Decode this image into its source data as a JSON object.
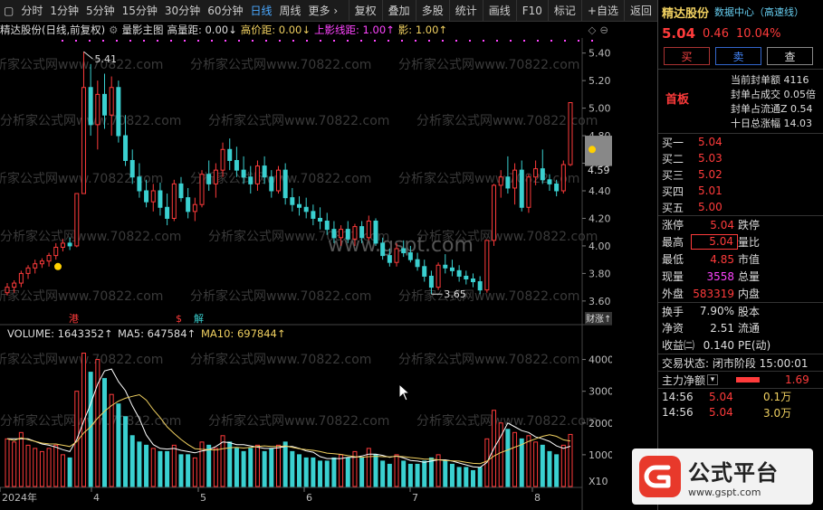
{
  "toolbar": {
    "items": [
      "分时",
      "1分钟",
      "5分钟",
      "15分钟",
      "30分钟",
      "60分钟",
      "日线",
      "周线",
      "更多 ›"
    ],
    "active_item": "日线",
    "tools": [
      "复权",
      "叠加",
      "多股",
      "统计",
      "画线",
      "F10",
      "标记",
      "+自选",
      "返回"
    ]
  },
  "infobar": {
    "stock_period": "精达股份(日线,前复权)",
    "mode": "量影主图",
    "high_vol_dist": "高量距: 0.00↓",
    "high_price_dist": "高价距: 0.00↓",
    "upper_shadow_dist": "上影线距: 1.00↑",
    "shadow": "影: 1.00↑"
  },
  "main_chart": {
    "y_ticks": [
      "5.40",
      "5.20",
      "5.00",
      "4.80",
      "4.60",
      "4.40",
      "4.20",
      "4.00",
      "3.80",
      "3.60"
    ],
    "y_min": 3.54,
    "y_max": 5.47,
    "high_label": "5.41",
    "low_label": "3.65",
    "current_price_label": "4.59",
    "markers": [
      "港",
      "$",
      "解"
    ],
    "right_badge": "财涨↑",
    "watermark_text": "分析家公式网www.70822.com",
    "site_text": "www.gspt.com"
  },
  "volume_chart": {
    "legend_volume": "VOLUME: 1643352↑",
    "legend_ma5": "MA5: 647584↑",
    "legend_ma10": "MA10: 697844↑",
    "y_ticks": [
      "40000",
      "30000",
      "20000",
      "10000"
    ],
    "y_unit": "X10",
    "x_labels": [
      "2024年",
      "4",
      "5",
      "6",
      "7",
      "8"
    ],
    "right_edge_label": "日"
  },
  "right_panel": {
    "name": "精达股份",
    "center": "数据中心（高速线）",
    "price": "5.04",
    "change": "0.46",
    "change_pct": "10.04%",
    "buy_label": "买",
    "sell_label": "卖",
    "query_label": "查",
    "board_label": "首板",
    "board_lines": [
      "当前封单额 4116",
      "封单占成交 0.05倍",
      "封单占流通Z 0.54",
      "十日总涨幅 14.03"
    ],
    "order_book": [
      {
        "label": "买一",
        "price": "5.04"
      },
      {
        "label": "买二",
        "price": "5.03"
      },
      {
        "label": "买三",
        "price": "5.02"
      },
      {
        "label": "买四",
        "price": "5.01"
      },
      {
        "label": "买五",
        "price": "5.00"
      }
    ],
    "stats": [
      {
        "l1": "涨停",
        "v1": "5.04",
        "l2": "跌停"
      },
      {
        "l1": "最高",
        "v1": "5.04",
        "l2": "量比"
      },
      {
        "l1": "最低",
        "v1": "4.85",
        "l2": "市值"
      },
      {
        "l1": "现量",
        "v1": "3558",
        "l2": "总量"
      },
      {
        "l1": "外盘",
        "v1": "583319",
        "l2": "内盘"
      },
      {
        "l1": "换手",
        "v1": "7.90%",
        "l2": "股本"
      },
      {
        "l1": "净资",
        "v1": "2.51",
        "l2": "流通"
      },
      {
        "l1": "收益㈡",
        "v1": "0.140",
        "l2": "PE(动)"
      }
    ],
    "status": "交易状态: 闭市阶段 15:00:01",
    "main_flow_label": "主力净额",
    "main_flow_value": "1.69",
    "ticks": [
      {
        "time": "14:56",
        "price": "5.04",
        "vol": "0.1万"
      },
      {
        "time": "14:56",
        "price": "5.04",
        "vol": "3.0万"
      }
    ]
  },
  "brand": {
    "title": "公式平台",
    "url": "www.gspt.com"
  },
  "colors": {
    "up": "#ff3b3b",
    "down": "#3ad0d0",
    "ma5": "#ffffff",
    "ma10": "#f0d060",
    "accent_yellow": "#ffd000"
  },
  "chart_data": {
    "type": "candlestick",
    "y_range": [
      3.54,
      5.47
    ],
    "candles": [
      {
        "o": 3.66,
        "h": 3.73,
        "l": 3.64,
        "c": 3.7,
        "v": 15000
      },
      {
        "o": 3.7,
        "h": 3.75,
        "l": 3.66,
        "c": 3.73,
        "v": 14000
      },
      {
        "o": 3.73,
        "h": 3.82,
        "l": 3.7,
        "c": 3.8,
        "v": 17000
      },
      {
        "o": 3.8,
        "h": 3.86,
        "l": 3.76,
        "c": 3.84,
        "v": 13000
      },
      {
        "o": 3.84,
        "h": 3.9,
        "l": 3.8,
        "c": 3.87,
        "v": 12000
      },
      {
        "o": 3.87,
        "h": 3.91,
        "l": 3.84,
        "c": 3.89,
        "v": 11000
      },
      {
        "o": 3.89,
        "h": 3.95,
        "l": 3.85,
        "c": 3.93,
        "v": 12000
      },
      {
        "o": 3.93,
        "h": 4.02,
        "l": 3.9,
        "c": 3.99,
        "v": 13000
      },
      {
        "o": 3.99,
        "h": 4.05,
        "l": 3.96,
        "c": 4.02,
        "v": 10000
      },
      {
        "o": 4.02,
        "h": 4.06,
        "l": 3.97,
        "c": 4.0,
        "v": 9000
      },
      {
        "o": 4.0,
        "h": 4.38,
        "l": 3.99,
        "c": 4.38,
        "v": 30000
      },
      {
        "o": 4.38,
        "h": 5.41,
        "l": 4.38,
        "c": 5.15,
        "v": 42000
      },
      {
        "o": 5.15,
        "h": 5.32,
        "l": 4.8,
        "c": 4.88,
        "v": 36000
      },
      {
        "o": 4.88,
        "h": 5.2,
        "l": 4.7,
        "c": 5.1,
        "v": 40000
      },
      {
        "o": 5.1,
        "h": 5.25,
        "l": 4.85,
        "c": 4.95,
        "v": 34000
      },
      {
        "o": 4.95,
        "h": 5.23,
        "l": 4.8,
        "c": 5.15,
        "v": 29000
      },
      {
        "o": 5.15,
        "h": 5.2,
        "l": 4.75,
        "c": 4.8,
        "v": 26000
      },
      {
        "o": 4.8,
        "h": 4.95,
        "l": 4.58,
        "c": 4.62,
        "v": 22000
      },
      {
        "o": 4.62,
        "h": 4.7,
        "l": 4.45,
        "c": 4.5,
        "v": 16000
      },
      {
        "o": 4.5,
        "h": 4.6,
        "l": 4.35,
        "c": 4.4,
        "v": 14000
      },
      {
        "o": 4.4,
        "h": 4.48,
        "l": 4.28,
        "c": 4.32,
        "v": 13000
      },
      {
        "o": 4.32,
        "h": 4.45,
        "l": 4.25,
        "c": 4.4,
        "v": 12000
      },
      {
        "o": 4.4,
        "h": 4.46,
        "l": 4.22,
        "c": 4.28,
        "v": 11000
      },
      {
        "o": 4.28,
        "h": 4.38,
        "l": 4.15,
        "c": 4.2,
        "v": 11000
      },
      {
        "o": 4.2,
        "h": 4.48,
        "l": 4.18,
        "c": 4.45,
        "v": 13000
      },
      {
        "o": 4.45,
        "h": 4.5,
        "l": 4.32,
        "c": 4.35,
        "v": 10000
      },
      {
        "o": 4.35,
        "h": 4.42,
        "l": 4.2,
        "c": 4.25,
        "v": 10000
      },
      {
        "o": 4.25,
        "h": 4.35,
        "l": 4.18,
        "c": 4.3,
        "v": 9000
      },
      {
        "o": 4.3,
        "h": 4.55,
        "l": 4.28,
        "c": 4.52,
        "v": 14000
      },
      {
        "o": 4.52,
        "h": 4.62,
        "l": 4.4,
        "c": 4.45,
        "v": 13000
      },
      {
        "o": 4.45,
        "h": 4.6,
        "l": 4.35,
        "c": 4.55,
        "v": 12000
      },
      {
        "o": 4.55,
        "h": 4.75,
        "l": 4.5,
        "c": 4.7,
        "v": 16000
      },
      {
        "o": 4.7,
        "h": 4.78,
        "l": 4.55,
        "c": 4.62,
        "v": 14000
      },
      {
        "o": 4.62,
        "h": 4.72,
        "l": 4.5,
        "c": 4.55,
        "v": 12000
      },
      {
        "o": 4.55,
        "h": 4.65,
        "l": 4.45,
        "c": 4.5,
        "v": 11000
      },
      {
        "o": 4.5,
        "h": 4.58,
        "l": 4.38,
        "c": 4.45,
        "v": 12000
      },
      {
        "o": 4.45,
        "h": 4.62,
        "l": 4.4,
        "c": 4.58,
        "v": 13000
      },
      {
        "o": 4.58,
        "h": 4.65,
        "l": 4.45,
        "c": 4.5,
        "v": 11000
      },
      {
        "o": 4.5,
        "h": 4.55,
        "l": 4.35,
        "c": 4.4,
        "v": 12000
      },
      {
        "o": 4.4,
        "h": 4.58,
        "l": 4.38,
        "c": 4.55,
        "v": 13000
      },
      {
        "o": 4.55,
        "h": 4.6,
        "l": 4.3,
        "c": 4.35,
        "v": 14000
      },
      {
        "o": 4.35,
        "h": 4.42,
        "l": 4.25,
        "c": 4.3,
        "v": 11000
      },
      {
        "o": 4.3,
        "h": 4.36,
        "l": 4.22,
        "c": 4.28,
        "v": 10000
      },
      {
        "o": 4.28,
        "h": 4.35,
        "l": 4.2,
        "c": 4.25,
        "v": 9000
      },
      {
        "o": 4.25,
        "h": 4.3,
        "l": 4.15,
        "c": 4.2,
        "v": 9000
      },
      {
        "o": 4.2,
        "h": 4.28,
        "l": 4.12,
        "c": 4.18,
        "v": 8000
      },
      {
        "o": 4.18,
        "h": 4.24,
        "l": 4.08,
        "c": 4.12,
        "v": 8000
      },
      {
        "o": 4.12,
        "h": 4.18,
        "l": 4.02,
        "c": 4.06,
        "v": 9000
      },
      {
        "o": 4.06,
        "h": 4.15,
        "l": 4.0,
        "c": 4.12,
        "v": 10000
      },
      {
        "o": 4.12,
        "h": 4.18,
        "l": 4.02,
        "c": 4.05,
        "v": 9000
      },
      {
        "o": 4.05,
        "h": 4.16,
        "l": 4.0,
        "c": 4.14,
        "v": 11000
      },
      {
        "o": 4.14,
        "h": 4.18,
        "l": 4.02,
        "c": 4.06,
        "v": 9000
      },
      {
        "o": 4.06,
        "h": 4.22,
        "l": 4.04,
        "c": 4.18,
        "v": 12000
      },
      {
        "o": 4.18,
        "h": 4.2,
        "l": 4.0,
        "c": 4.02,
        "v": 10000
      },
      {
        "o": 4.02,
        "h": 4.06,
        "l": 3.9,
        "c": 3.93,
        "v": 8000
      },
      {
        "o": 3.93,
        "h": 3.98,
        "l": 3.85,
        "c": 3.88,
        "v": 7000
      },
      {
        "o": 3.88,
        "h": 4.02,
        "l": 3.85,
        "c": 3.98,
        "v": 10000
      },
      {
        "o": 3.98,
        "h": 4.04,
        "l": 3.92,
        "c": 3.95,
        "v": 8000
      },
      {
        "o": 3.95,
        "h": 4.0,
        "l": 3.88,
        "c": 3.9,
        "v": 7000
      },
      {
        "o": 3.9,
        "h": 3.95,
        "l": 3.82,
        "c": 3.85,
        "v": 7000
      },
      {
        "o": 3.85,
        "h": 3.9,
        "l": 3.74,
        "c": 3.78,
        "v": 8000
      },
      {
        "o": 3.78,
        "h": 3.82,
        "l": 3.65,
        "c": 3.7,
        "v": 9000
      },
      {
        "o": 3.7,
        "h": 3.88,
        "l": 3.68,
        "c": 3.86,
        "v": 10000
      },
      {
        "o": 3.86,
        "h": 3.94,
        "l": 3.8,
        "c": 3.84,
        "v": 8000
      },
      {
        "o": 3.84,
        "h": 3.9,
        "l": 3.78,
        "c": 3.82,
        "v": 7000
      },
      {
        "o": 3.82,
        "h": 3.86,
        "l": 3.74,
        "c": 3.78,
        "v": 6000
      },
      {
        "o": 3.78,
        "h": 3.82,
        "l": 3.72,
        "c": 3.76,
        "v": 6000
      },
      {
        "o": 3.76,
        "h": 3.8,
        "l": 3.7,
        "c": 3.74,
        "v": 5000
      },
      {
        "o": 3.74,
        "h": 3.78,
        "l": 3.65,
        "c": 3.68,
        "v": 6000
      },
      {
        "o": 3.68,
        "h": 4.04,
        "l": 3.66,
        "c": 4.04,
        "v": 15000
      },
      {
        "o": 4.04,
        "h": 4.45,
        "l": 4.0,
        "c": 4.44,
        "v": 24000
      },
      {
        "o": 4.44,
        "h": 4.55,
        "l": 4.35,
        "c": 4.5,
        "v": 20000
      },
      {
        "o": 4.5,
        "h": 4.65,
        "l": 4.38,
        "c": 4.42,
        "v": 18000
      },
      {
        "o": 4.42,
        "h": 4.6,
        "l": 4.3,
        "c": 4.55,
        "v": 17000
      },
      {
        "o": 4.55,
        "h": 4.62,
        "l": 4.25,
        "c": 4.28,
        "v": 15000
      },
      {
        "o": 4.28,
        "h": 4.52,
        "l": 4.24,
        "c": 4.5,
        "v": 16000
      },
      {
        "o": 4.5,
        "h": 4.62,
        "l": 4.44,
        "c": 4.56,
        "v": 14000
      },
      {
        "o": 4.56,
        "h": 4.7,
        "l": 4.45,
        "c": 4.48,
        "v": 13000
      },
      {
        "o": 4.48,
        "h": 4.52,
        "l": 4.4,
        "c": 4.45,
        "v": 11000
      },
      {
        "o": 4.45,
        "h": 4.48,
        "l": 4.36,
        "c": 4.4,
        "v": 10000
      },
      {
        "o": 4.4,
        "h": 4.62,
        "l": 4.38,
        "c": 4.59,
        "v": 13000
      },
      {
        "o": 4.59,
        "h": 5.04,
        "l": 4.58,
        "c": 5.04,
        "v": 16400
      }
    ],
    "ma5_points": [
      15000,
      15000,
      15000,
      15000,
      14200,
      13400,
      13000,
      12400,
      11600,
      11000,
      14800,
      20600,
      26000,
      32200,
      36400,
      37000,
      33000,
      30200,
      25400,
      21400,
      16200,
      13200,
      12000,
      11800,
      12000,
      11400,
      11000,
      10600,
      11200,
      11600,
      12600,
      14000,
      13800,
      13200,
      13200,
      12800,
      12400,
      12000,
      12000,
      12200,
      12600,
      12600,
      12000,
      11200,
      10800,
      9400,
      8800,
      8800,
      8800,
      9200,
      9200,
      9600,
      10200,
      10200,
      9800,
      9200,
      9600,
      9000,
      8200,
      8000,
      7600,
      8000,
      8400,
      8400,
      8000,
      7400,
      6800,
      6200,
      6000,
      7600,
      12000,
      15800,
      20000,
      18800,
      17600,
      17000,
      15600,
      15000,
      14200,
      12800,
      12000,
      12680
    ]
  }
}
